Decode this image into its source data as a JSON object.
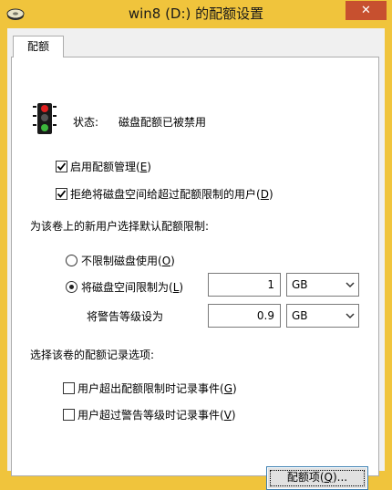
{
  "window": {
    "title": "win8 (D:) 的配额设置",
    "close_glyph": "✕"
  },
  "tab": {
    "label": "配额"
  },
  "status": {
    "label": "状态:",
    "value": "磁盘配额已被禁用"
  },
  "options": {
    "enable_quota": {
      "label": "启用配额管理(",
      "key": "E",
      "suffix": ")",
      "checked": true
    },
    "deny_space": {
      "label": "拒绝将磁盘空间给超过配额限制的用户(",
      "key": "D",
      "suffix": ")",
      "checked": true
    }
  },
  "default_limit": {
    "heading": "为该卷上的新用户选择默认配额限制:",
    "no_limit": {
      "label": "不限制磁盘使用(",
      "key": "O",
      "suffix": ")",
      "selected": false
    },
    "limit": {
      "label": "将磁盘空间限制为(",
      "key": "L",
      "suffix": ")",
      "selected": true,
      "value": "1",
      "unit": "GB"
    },
    "warning": {
      "label": "将警告等级设为",
      "value": "0.9",
      "unit": "GB"
    }
  },
  "logging": {
    "heading": "选择该卷的配额记录选项:",
    "log_exceed_limit": {
      "label": "用户超出配额限制时记录事件(",
      "key": "G",
      "suffix": ")",
      "checked": false
    },
    "log_exceed_warning": {
      "label": "用户超过警告等级时记录事件(",
      "key": "V",
      "suffix": ")",
      "checked": false
    }
  },
  "buttons": {
    "quota_entries": {
      "label": "配额项(",
      "key": "Q",
      "suffix": ")..."
    }
  },
  "icons": {
    "title_icon": "drive-icon",
    "status_icon": "traffic-light-icon"
  },
  "colors": {
    "title_bar": "#f0c43c",
    "close_button": "#c7502f",
    "traffic_red": "#e02020",
    "traffic_green": "#3db83d"
  }
}
